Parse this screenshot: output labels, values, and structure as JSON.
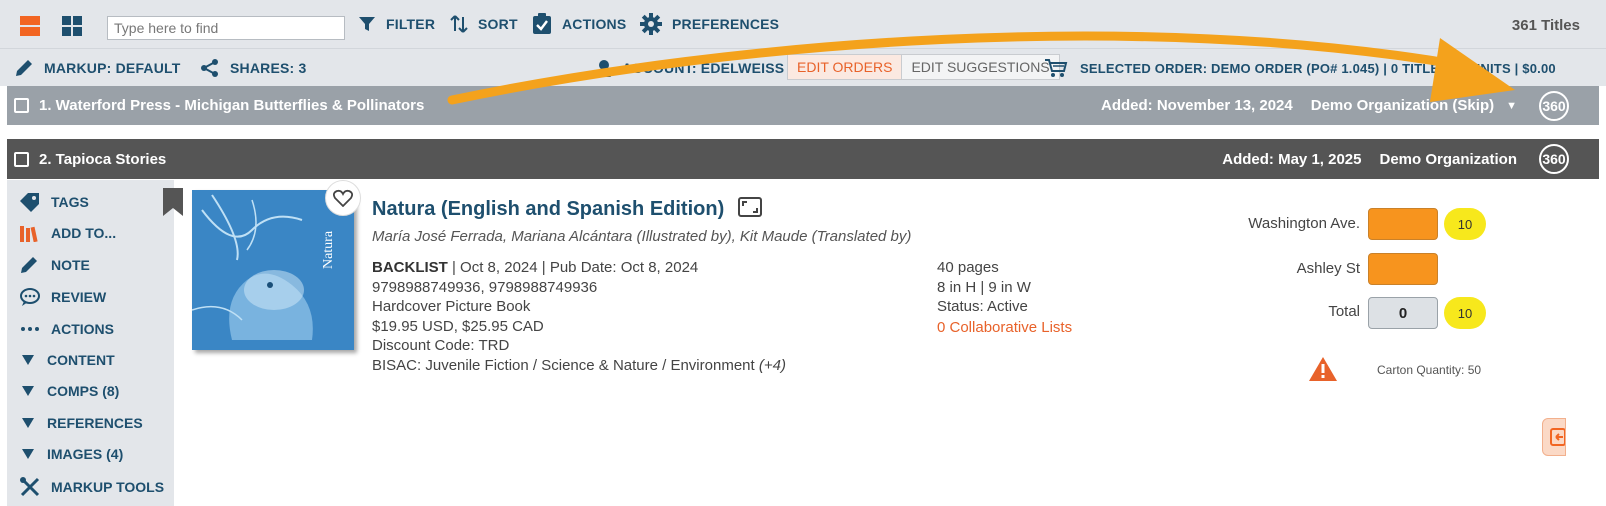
{
  "toolbar": {
    "search_placeholder": "Type here to find",
    "filter_label": "FILTER",
    "sort_label": "SORT",
    "actions_label": "ACTIONS",
    "preferences_label": "PREFERENCES",
    "titles_count": "361 Titles"
  },
  "subbar": {
    "markup_label": "MARKUP: DEFAULT",
    "shares_label": "SHARES: 3",
    "account_label": "ACCOUNT: EDELWEISS",
    "edit_orders_label": "EDIT ORDERS",
    "edit_suggestions_label": "EDIT SUGGESTIONS",
    "selected_order_label": "SELECTED ORDER: DEMO ORDER (PO# 1.045) | 0 TITLES | 0 UNITS | $0.00"
  },
  "groups": [
    {
      "title": "1. Waterford Press - Michigan Butterflies & Pollinators",
      "added": "Added: November 13, 2024",
      "org": "Demo Organization (Skip)",
      "badge": "360"
    },
    {
      "title": "2. Tapioca Stories",
      "added": "Added: May 1, 2025",
      "org": "Demo Organization",
      "badge": "360"
    }
  ],
  "sidebar": {
    "items": [
      {
        "label": "TAGS",
        "icon": "tag-icon"
      },
      {
        "label": "ADD TO...",
        "icon": "books-icon"
      },
      {
        "label": "NOTE",
        "icon": "pencil-icon"
      },
      {
        "label": "REVIEW",
        "icon": "speech-bubble-icon"
      },
      {
        "label": "ACTIONS",
        "icon": "ellipsis-icon"
      },
      {
        "label": "CONTENT",
        "icon": "caret-down-icon"
      },
      {
        "label": "COMPS (8)",
        "icon": "caret-down-icon"
      },
      {
        "label": "REFERENCES",
        "icon": "caret-down-icon"
      },
      {
        "label": "IMAGES (4)",
        "icon": "caret-down-icon"
      },
      {
        "label": "MARKUP TOOLS",
        "icon": "tools-icon"
      }
    ]
  },
  "product": {
    "title": "Natura (English and Spanish Edition)",
    "cover_text": "Natura",
    "contributors": "María José Ferrada, Mariana Alcántara (Illustrated by), Kit Maude (Translated by)",
    "status_word": "BACKLIST",
    "dates": " | Oct 8, 2024 | Pub Date: Oct 8, 2024",
    "isbns": "9798988749936, 9798988749936",
    "format": "Hardcover Picture Book",
    "price": "$19.95 USD, $25.95 CAD",
    "discount": "Discount Code: TRD",
    "bisac": "BISAC: Juvenile Fiction / Science & Nature / Environment",
    "bisac_more": "(+4)",
    "pages": "40 pages",
    "dimensions": "8 in H | 9 in W",
    "status": "Status: Active",
    "collab_lists": "0 Collaborative Lists"
  },
  "order": {
    "locations": [
      {
        "label": "Washington Ave.",
        "badge": "10"
      },
      {
        "label": "Ashley St",
        "badge": ""
      }
    ],
    "total_label": "Total",
    "total_value": "0",
    "total_badge": "10",
    "carton_quantity": "Carton Quantity: 50"
  },
  "colors": {
    "brand_navy": "#1e4f6e",
    "accent_orange": "#f7941e",
    "link_orange": "#e8622a",
    "badge_yellow": "#f7e81c",
    "row1_header": "#9aa1a8",
    "row2_header": "#555555"
  }
}
